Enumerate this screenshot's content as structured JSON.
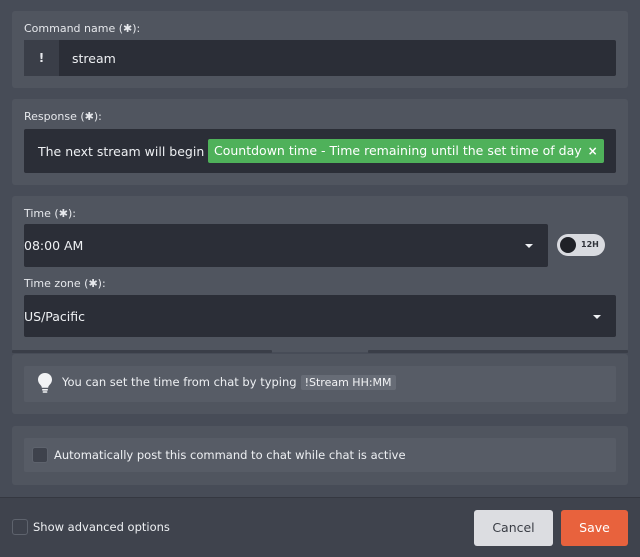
{
  "command": {
    "label": "Command name (",
    "label_star": "✱",
    "label_end": "):",
    "prefix": "!",
    "value": "stream"
  },
  "response": {
    "label": "Response (",
    "label_star": "✱",
    "label_end": "):",
    "text": "The next stream will begin in",
    "chip_text": "Countdown time - Time remaining until the set time of day",
    "chip_remove": "×"
  },
  "time": {
    "label": "Time (",
    "label_star": "✱",
    "label_end": "):",
    "value": "08:00 AM",
    "toggle_label": "12H"
  },
  "timezone": {
    "label": "Time zone (",
    "label_star": "✱",
    "label_end": "):",
    "value": "US/Pacific"
  },
  "tip": {
    "text": "You can set the time from chat by typing",
    "code": "!Stream HH:MM"
  },
  "autopost": {
    "label": "Automatically post this command to chat while chat is active",
    "checked": false
  },
  "footer": {
    "advanced_label": "Show advanced options",
    "advanced_checked": false,
    "cancel_label": "Cancel",
    "save_label": "Save"
  },
  "colors": {
    "background": "#474c57",
    "card": "#50555f",
    "field": "#2b2e37",
    "chip": "#4fb15a",
    "save": "#e8623d",
    "cancel": "#dcdde1"
  }
}
